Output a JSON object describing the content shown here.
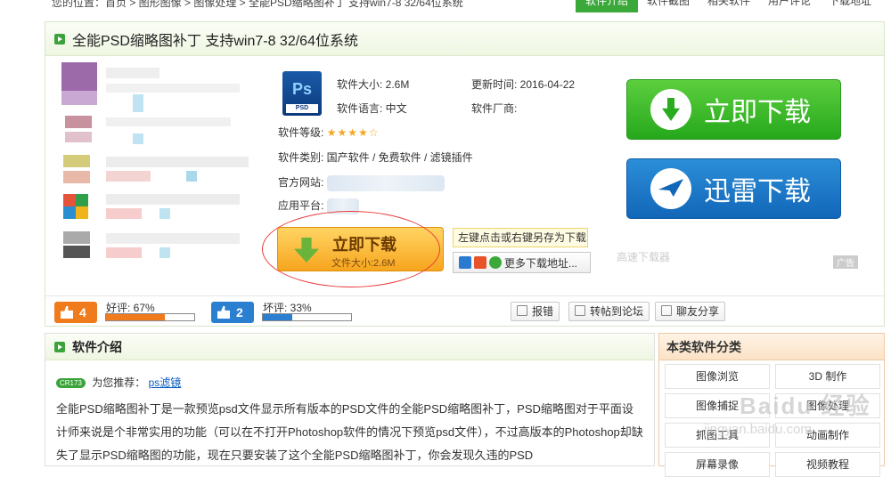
{
  "topbar": {
    "crumbs": "您的位置：首页 > 图形图像 > 图像处理 > 全能PSD缩略图补丁 支持win7-8 32/64位系统",
    "tabs": [
      "软件介绍",
      "软件截图",
      "相关软件",
      "用户评论",
      "下载地址"
    ]
  },
  "title": "全能PSD缩略图补丁  支持win7-8 32/64位系统",
  "meta": {
    "size_label": "软件大小: 2.6M",
    "update_label": "更新时间: 2016-04-22",
    "lang_label": "软件语言: 中文",
    "vendor_label": "软件厂商:",
    "rating_label": "软件等级:",
    "rating_stars": "★★★★☆",
    "rating_value": 4,
    "rating_max": 5,
    "category_label": "软件类别: 国产软件 / 免费软件 / 滤镜插件",
    "site_label": "官方网站:",
    "platform_label": "应用平台:"
  },
  "download": {
    "big_green": "立即下载",
    "big_blue": "迅雷下载",
    "orange_title": "立即下载",
    "orange_sub": "文件大小:2.6M",
    "tip": "左键点击或右键另存为下载",
    "more": "更多下载地址...",
    "gaosu": "高速下载器",
    "ad": "广告"
  },
  "votes": {
    "up_count": "4",
    "up_label": "好评: 67%",
    "up_ratio": 0.67,
    "down_count": "2",
    "down_label": "坏评: 33%",
    "down_ratio": 0.33,
    "actions": [
      "报错",
      "转帖到论坛",
      "聊友分享"
    ]
  },
  "intro": {
    "title": "软件介绍",
    "badge": "CR173",
    "recommend": "为您推荐：",
    "recommend_link": "ps滤镜",
    "body": "全能PSD缩略图补丁是一款预览psd文件显示所有版本的PSD文件的全能PSD缩略图补丁，PSD缩略图对于平面设计师来说是个非常实用的功能（可以在不打开Photoshop软件的情况下预览psd文件），不过高版本的Photoshop却缺失了显示PSD缩略图的功能，现在只要安装了这个全能PSD缩略图补丁，你会发现久违的PSD"
  },
  "category": {
    "title": "本类软件分类",
    "items": [
      "图像浏览",
      "3D 制作",
      "图像捕捉",
      "图像处理",
      "抓图工具",
      "动画制作",
      "屏幕录像",
      "视频教程"
    ]
  },
  "watermark": {
    "main": "Baidu 经验",
    "sub": "jingyan.baidu.com"
  },
  "colors": {
    "green": "#26a81c",
    "blue": "#1266b8",
    "orange": "#f7a51e",
    "red": "#e83a3a"
  }
}
